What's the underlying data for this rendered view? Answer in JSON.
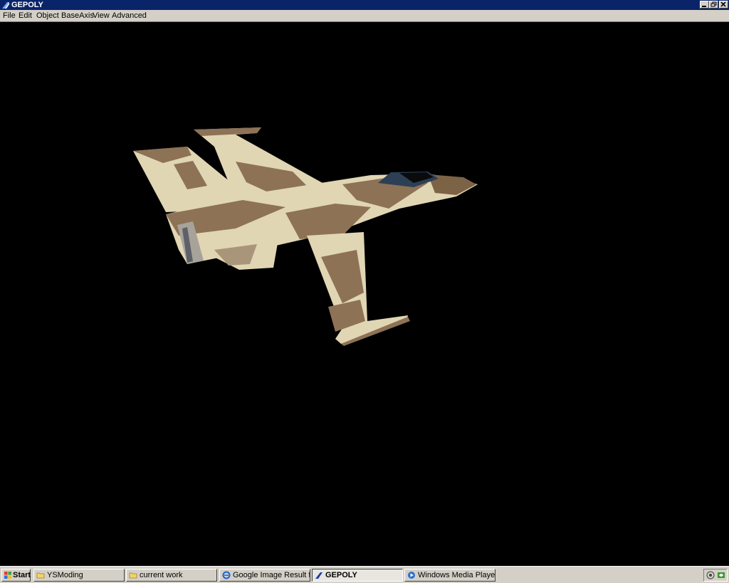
{
  "window": {
    "title": "GEPOLY"
  },
  "menu": {
    "items": [
      "File",
      "Edit",
      "Object",
      "BaseAxis",
      "View",
      "Advanced"
    ]
  },
  "taskbar": {
    "start_label": "Start",
    "tasks": [
      {
        "label": "YSModing",
        "icon": "folder-icon"
      },
      {
        "label": "current work",
        "icon": "folder-icon"
      },
      {
        "label": "Google Image Result for ...",
        "icon": "ie-icon"
      },
      {
        "label": "GEPOLY",
        "icon": "gepoly-icon",
        "active": true
      },
      {
        "label": "Windows Media Player",
        "icon": "media-player-icon"
      }
    ]
  },
  "colors": {
    "titlebar": "#0a246a",
    "face": "#d4d0c8",
    "camo_light": "#e0d6b4",
    "camo_dark": "#8d7256",
    "viewport": "#000000"
  }
}
